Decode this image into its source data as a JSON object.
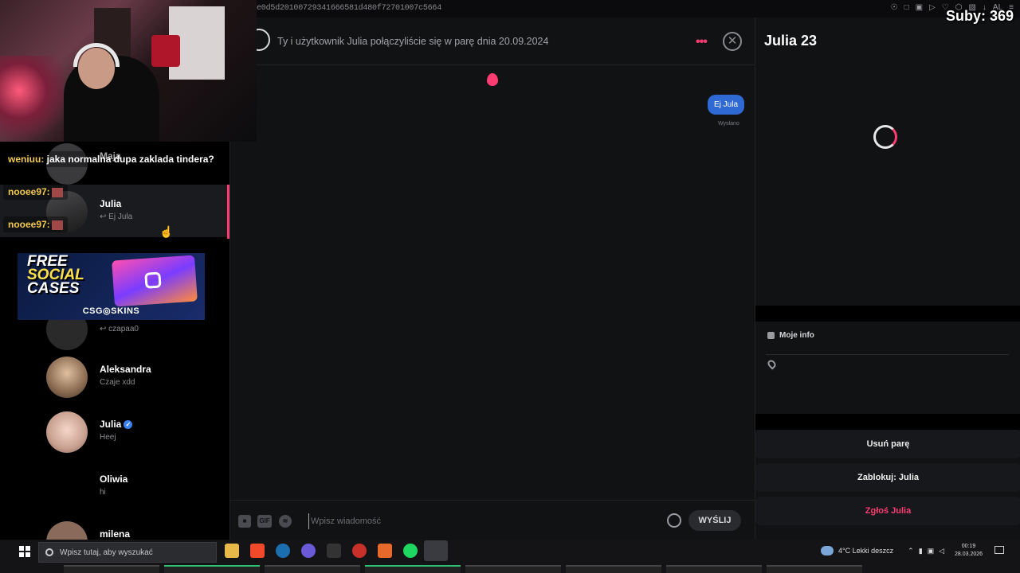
{
  "browser": {
    "url": "e0d5d2010072934166658​1d480f72701007c5664",
    "icons": [
      "pin-icon",
      "tab-icon",
      "shield-icon",
      "play-icon",
      "heart-icon",
      "extension-icon",
      "puzzle-icon",
      "download-icon",
      "profile-icon",
      "menu-icon"
    ]
  },
  "overlay": {
    "subs": "Suby: 369",
    "chat": [
      {
        "user": "weniuu:",
        "msg": "jaka normalna dupa zaklada tindera?"
      },
      {
        "user": "nooee97:",
        "msg": ""
      },
      {
        "user": "nooee97:",
        "msg": ""
      }
    ],
    "promo": {
      "line1": "FREE",
      "line2": "SOCIAL",
      "line3": "CASES",
      "brand": "CSG◎SKINS"
    }
  },
  "sidebar": {
    "matches": [
      {
        "name": "Maja",
        "last": ""
      },
      {
        "name": "Julia",
        "last": "↩ Ej Jula",
        "active": true
      },
      {
        "name": "",
        "last": "↩ czapaa0"
      },
      {
        "name": "Aleksandra",
        "last": "Czaje xdd"
      },
      {
        "name": "Julia",
        "last": "Heej",
        "verified": true
      },
      {
        "name": "Oliwia",
        "last": "hi"
      },
      {
        "name": "milena",
        "last": ""
      }
    ]
  },
  "chat": {
    "match_text": "Ty i użytkownik Julia połączyliście się w parę dnia 20.09.2024",
    "messages": [
      {
        "text": "Ej Jula",
        "status": "Wysłano"
      }
    ],
    "composer": {
      "placeholder": "Wpisz wiadomość",
      "send_label": "WYŚLIJ",
      "gif_label": "GIF"
    },
    "accent": "#fe3c72"
  },
  "profile": {
    "name": "Julia 23",
    "info_heading": "Moje info",
    "buttons": {
      "unmatch": "Usuń parę",
      "block": "Zablokuj: Julia",
      "report": "Zgłoś Julia"
    }
  },
  "taskbar": {
    "search_placeholder": "Wpisz tutaj, aby wyszukać",
    "weather": "4°C  Lekki deszcz",
    "time": "00:19",
    "date": "28.03.2026",
    "apps": [
      "file-explorer-icon",
      "brave-icon",
      "steam-icon",
      "discord-icon",
      "epic-icon",
      "opera-icon",
      "affinity-icon",
      "spotify-icon",
      "app-icon"
    ]
  }
}
